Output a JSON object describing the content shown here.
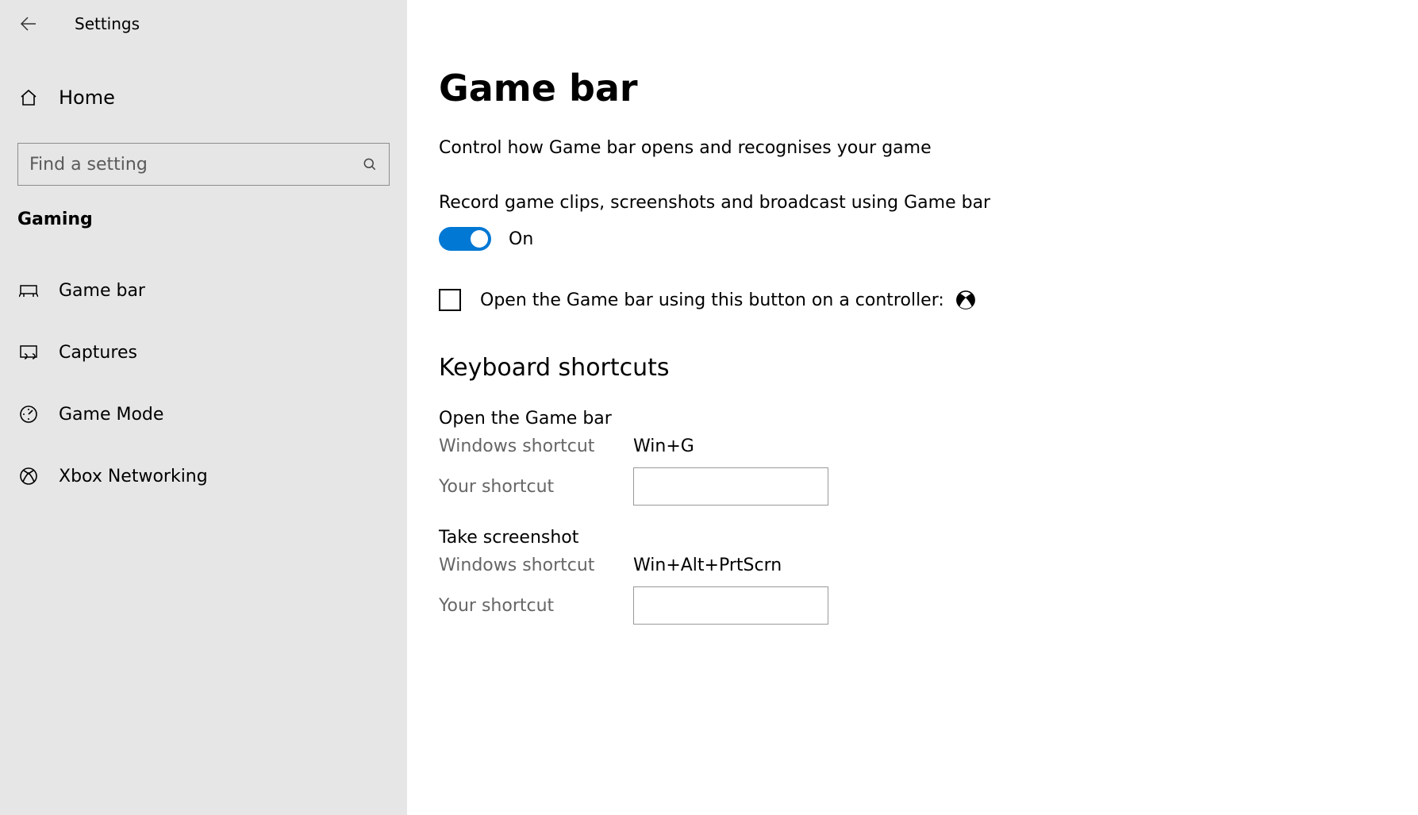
{
  "header": {
    "title": "Settings"
  },
  "sidebar": {
    "home_label": "Home",
    "search_placeholder": "Find a setting",
    "category": "Gaming",
    "items": [
      {
        "label": "Game bar"
      },
      {
        "label": "Captures"
      },
      {
        "label": "Game Mode"
      },
      {
        "label": "Xbox Networking"
      }
    ]
  },
  "main": {
    "title": "Game bar",
    "subtitle": "Control how Game bar opens and recognises your game",
    "record_label": "Record game clips, screenshots and broadcast using Game bar",
    "toggle_state": "On",
    "controller_label": "Open the Game bar using this button on a controller:",
    "shortcuts_title": "Keyboard shortcuts",
    "shortcuts": [
      {
        "name": "Open the Game bar",
        "win_label": "Windows shortcut",
        "win_value": "Win+G",
        "your_label": "Your shortcut",
        "your_value": ""
      },
      {
        "name": "Take screenshot",
        "win_label": "Windows shortcut",
        "win_value": "Win+Alt+PrtScrn",
        "your_label": "Your shortcut",
        "your_value": ""
      }
    ]
  }
}
